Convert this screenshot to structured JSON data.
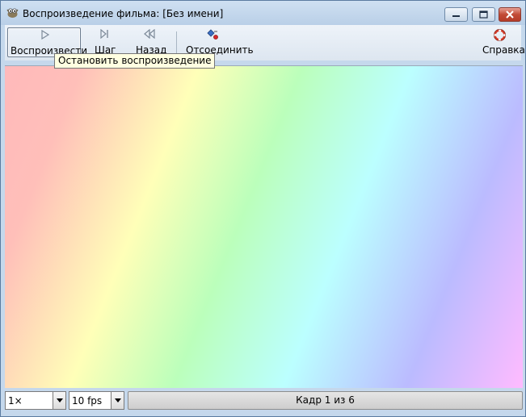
{
  "window": {
    "title": "Воспроизведение фильма: [Без имени]",
    "icon": "gimp-wilber-icon"
  },
  "window_controls": {
    "minimize_icon": "minimize-icon",
    "maximize_icon": "maximize-icon",
    "close_icon": "close-icon"
  },
  "toolbar": {
    "play": {
      "label": "Воспроизвести",
      "icon": "play-icon",
      "pressed": true
    },
    "step": {
      "label": "Шаг",
      "icon": "step-forward-icon"
    },
    "back": {
      "label": "Назад",
      "icon": "step-back-icon"
    },
    "detach": {
      "label": "Отсоединить",
      "icon": "detach-icon"
    },
    "help": {
      "label": "Справка",
      "icon": "lifebuoy-icon"
    }
  },
  "tooltip": {
    "text": "Остановить воспроизведение"
  },
  "statusbar": {
    "speed": {
      "value": "1×"
    },
    "fps": {
      "value": "10 fps"
    },
    "frame_label": "Кадр 1 из 6"
  }
}
